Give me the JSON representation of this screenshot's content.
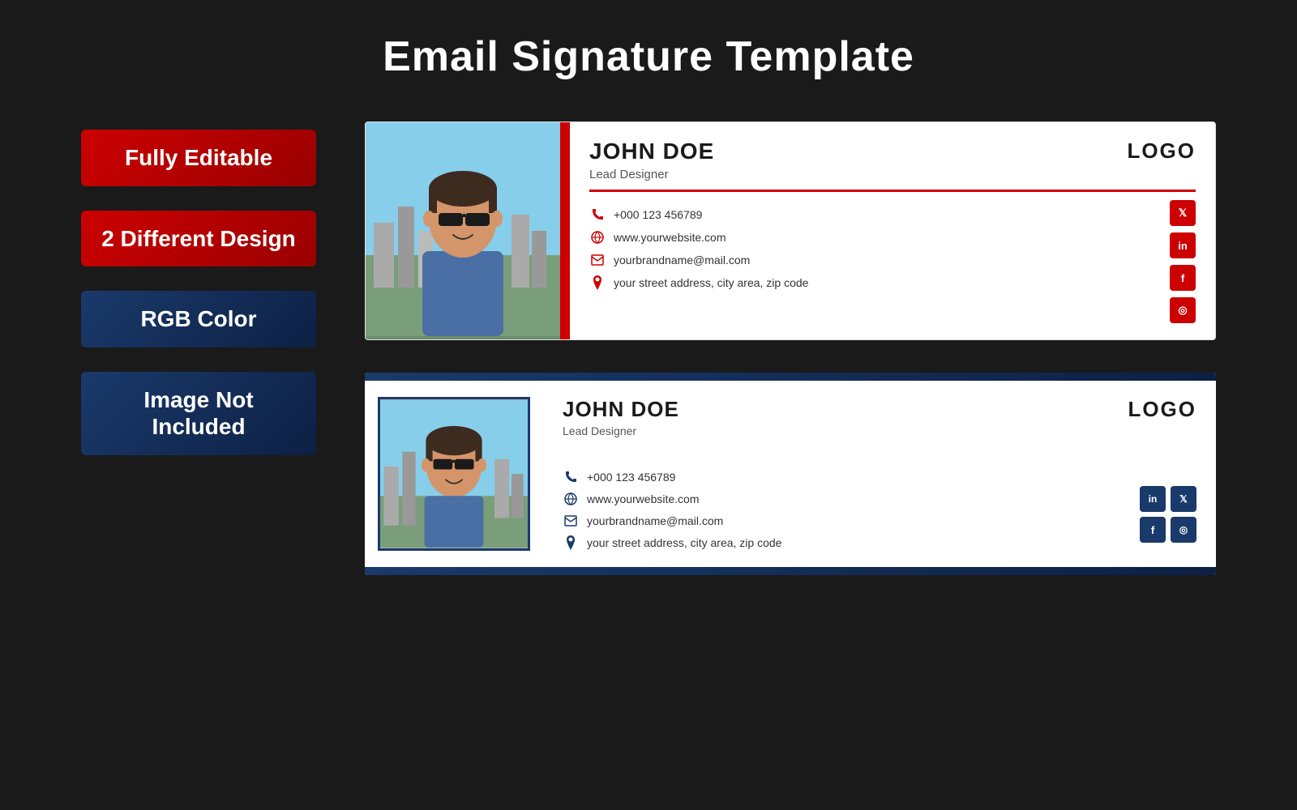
{
  "page": {
    "title": "Email Signature Template",
    "background": "#1a1a1a"
  },
  "badges": [
    {
      "id": "fully-editable",
      "text": "Fully Editable",
      "theme": "red"
    },
    {
      "id": "different-design",
      "text": "2 Different Design",
      "theme": "red"
    },
    {
      "id": "rgb-color",
      "text": "RGB Color",
      "theme": "blue"
    },
    {
      "id": "image-not-included",
      "text": "Image Not Included",
      "theme": "blue"
    }
  ],
  "signature1": {
    "name": "JOHN DOE",
    "role": "Lead Designer",
    "logo": "LOGO",
    "phone": "+000 123 456789",
    "website": "www.yourwebsite.com",
    "email": "yourbrandname@mail.com",
    "address": "your street address, city area, zip code",
    "social": [
      "T",
      "in",
      "f",
      "ig"
    ]
  },
  "signature2": {
    "name": "JOHN DOE",
    "role": "Lead Designer",
    "logo": "LOGO",
    "phone": "+000 123 456789",
    "website": "www.yourwebsite.com",
    "email": "yourbrandname@mail.com",
    "address": "your street address, city area, zip code",
    "social": [
      "in",
      "T",
      "f",
      "ig"
    ]
  }
}
